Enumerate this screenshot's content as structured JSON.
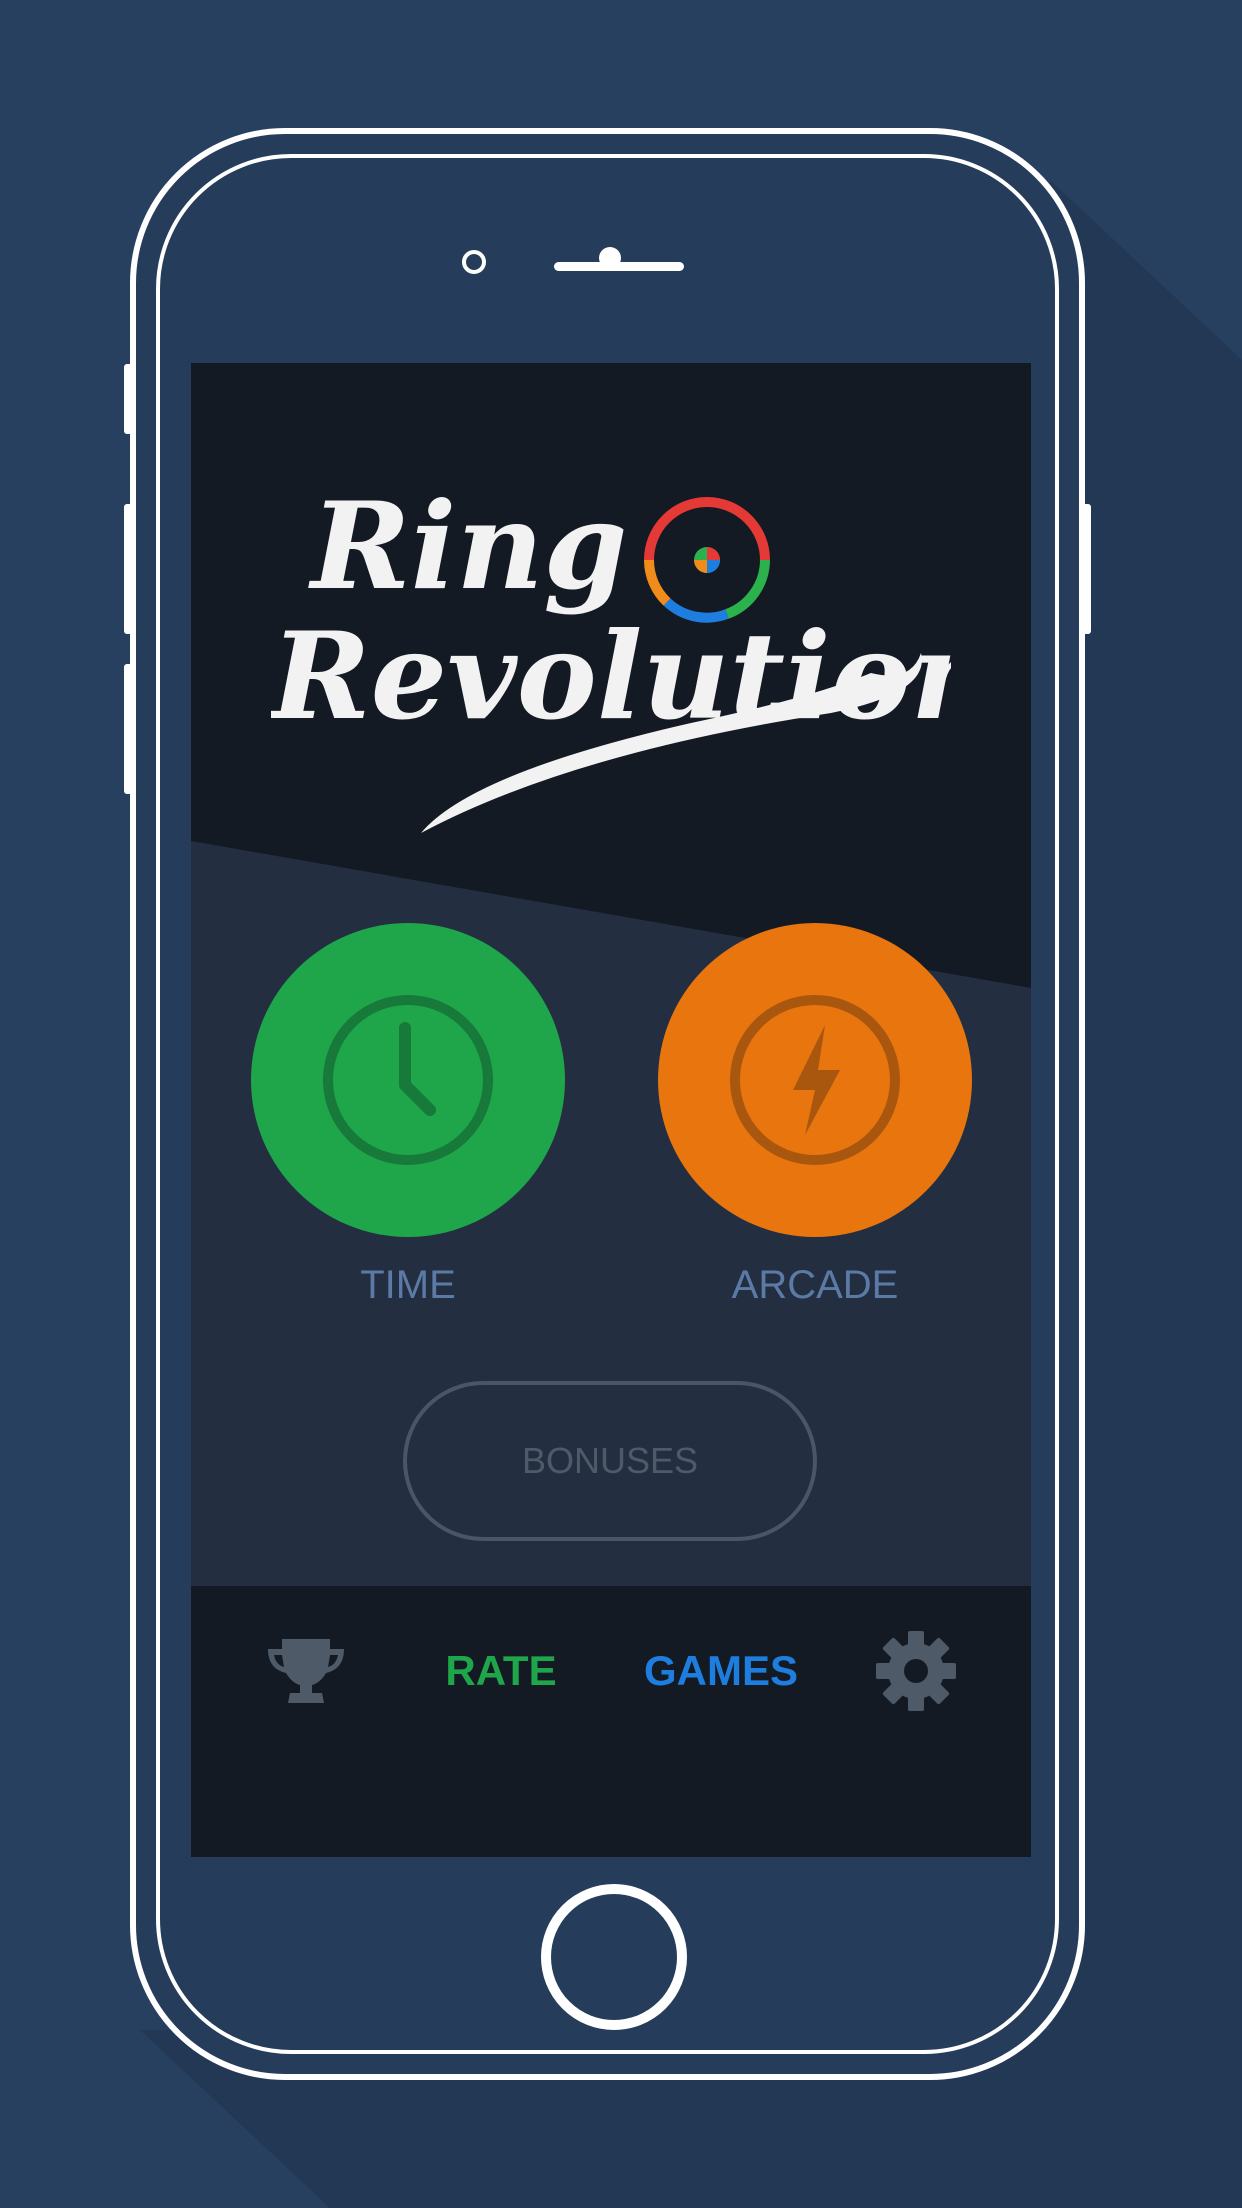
{
  "app": {
    "title_line1": "Ring",
    "title_line2": "Revolution"
  },
  "modes": [
    {
      "label": "TIME",
      "icon": "clock-icon",
      "color": "#1fa64a"
    },
    {
      "label": "ARCADE",
      "icon": "lightning-icon",
      "color": "#e8750d"
    }
  ],
  "bonuses_label": "BONUSES",
  "nav": {
    "trophy_icon": "trophy-icon",
    "rate_label": "RATE",
    "games_label": "GAMES",
    "settings_icon": "gear-icon"
  },
  "colors": {
    "background": "#27405f",
    "screen_top": "#141a24",
    "screen_mid": "#232f41",
    "green": "#1fa64a",
    "orange": "#e8750d",
    "blue": "#1e7ee0",
    "label_blue": "#5b7ba6"
  }
}
